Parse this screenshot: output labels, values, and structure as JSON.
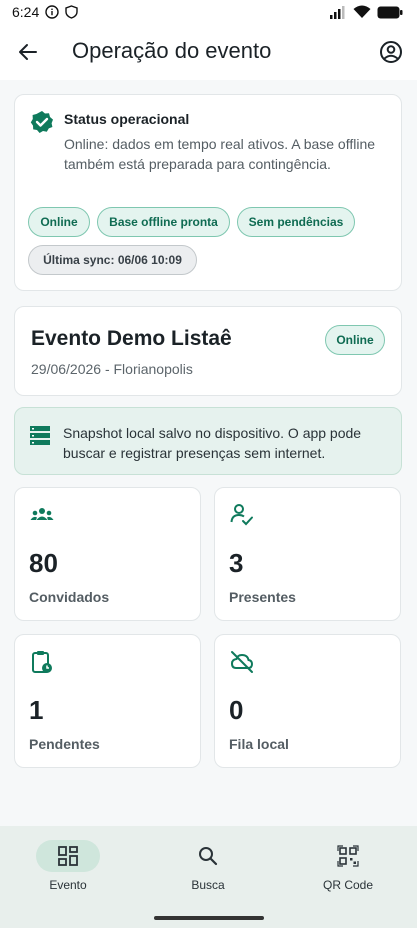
{
  "status_bar": {
    "time": "6:24"
  },
  "app_bar": {
    "title": "Operação do evento"
  },
  "status_card": {
    "heading": "Status operacional",
    "description": "Online: dados em tempo real ativos. A base offline também está preparada para contingência.",
    "chips": [
      "Online",
      "Base offline pronta",
      "Sem pendências",
      "Última sync: 06/06 10:09"
    ]
  },
  "event": {
    "name": "Evento Demo Listaê",
    "meta": "29/06/2026 - Florianopolis",
    "badge": "Online"
  },
  "notice": {
    "text": "Snapshot local salvo no dispositivo. O app pode buscar e registrar presenças sem internet."
  },
  "stats": [
    {
      "value": "80",
      "label": "Convidados",
      "icon": "groups-icon"
    },
    {
      "value": "3",
      "label": "Presentes",
      "icon": "person-check-icon"
    },
    {
      "value": "1",
      "label": "Pendentes",
      "icon": "clipboard-clock-icon"
    },
    {
      "value": "0",
      "label": "Fila local",
      "icon": "cloud-off-icon"
    }
  ],
  "bottom_nav": [
    {
      "label": "Evento",
      "icon": "dashboard-icon",
      "active": true
    },
    {
      "label": "Busca",
      "icon": "search-icon",
      "active": false
    },
    {
      "label": "QR Code",
      "icon": "qr-code-icon",
      "active": false
    }
  ],
  "colors": {
    "accent": "#0f7a5c",
    "chip_bg": "#e4f4ef",
    "nav_bg": "#e8efec"
  }
}
